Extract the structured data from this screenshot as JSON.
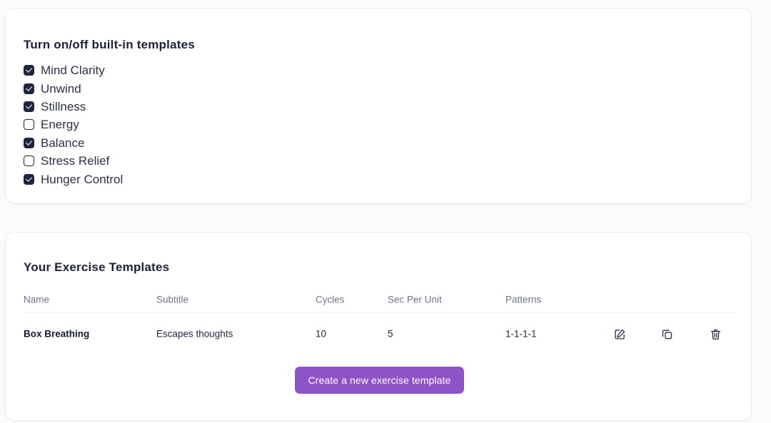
{
  "colors": {
    "page_background": "#fbfbfc",
    "card_background": "#ffffff",
    "card_border": "#e8eaf0",
    "checkbox_checked": "#1f2440",
    "button_purple": "#8e53c6",
    "table_header_text": "#6c7486",
    "divider": "#eceef3"
  },
  "templates_card": {
    "title": "Turn on/off built-in templates",
    "items": [
      {
        "label": "Mind Clarity",
        "checked": true
      },
      {
        "label": "Unwind",
        "checked": true
      },
      {
        "label": "Stillness",
        "checked": true
      },
      {
        "label": "Energy",
        "checked": false
      },
      {
        "label": "Balance",
        "checked": true
      },
      {
        "label": "Stress Relief",
        "checked": false
      },
      {
        "label": "Hunger Control",
        "checked": true
      }
    ]
  },
  "exercises_card": {
    "title": "Your Exercise Templates",
    "table": {
      "columns": [
        "Name",
        "Subtitle",
        "Cycles",
        "Sec Per Unit",
        "Patterns"
      ],
      "rows": [
        {
          "name": "Box Breathing",
          "subtitle": "Escapes thoughts",
          "cycles": "10",
          "sec_per_unit": "5",
          "patterns": "1-1-1-1",
          "actions": [
            "edit-icon",
            "copy-icon",
            "trash-icon"
          ]
        }
      ]
    },
    "create_button_label": "Create a new exercise template"
  }
}
